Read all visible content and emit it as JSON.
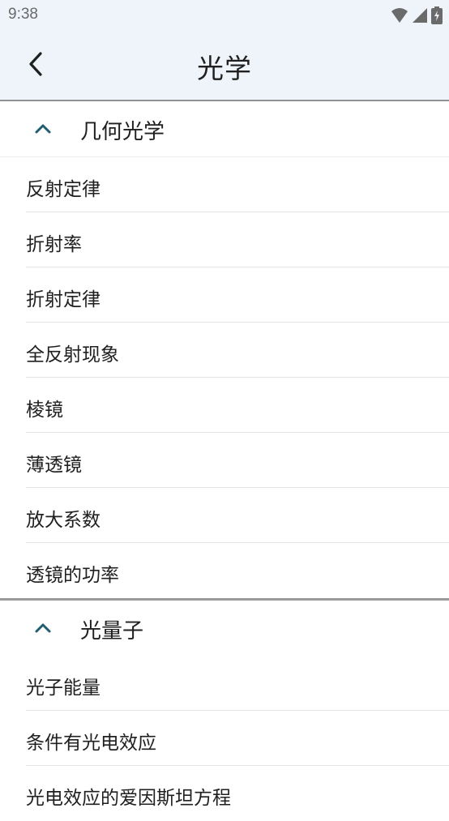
{
  "status_bar": {
    "time": "9:38"
  },
  "app_bar": {
    "title": "光学"
  },
  "sections": [
    {
      "title": "几何光学",
      "items": [
        "反射定律",
        "折射率",
        "折射定律",
        "全反射现象",
        "棱镜",
        "薄透镜",
        "放大系数",
        "透镜的功率"
      ]
    },
    {
      "title": "光量子",
      "items": [
        "光子能量",
        "条件有光电效应",
        "光电效应的爱因斯坦方程"
      ]
    }
  ],
  "colors": {
    "accent": "#1e5e6e",
    "app_bar_bg": "#eef4fa"
  }
}
